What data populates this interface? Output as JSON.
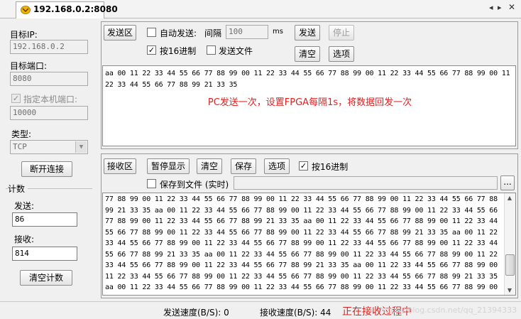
{
  "tab": {
    "title": "192.168.0.2:8080"
  },
  "left": {
    "target_ip_label": "目标IP:",
    "target_ip": "192.168.0.2",
    "target_port_label": "目标端口:",
    "target_port": "8080",
    "local_port_label": "指定本机端口:",
    "local_port": "10000",
    "type_label": "类型:",
    "type_value": "TCP",
    "disconnect_button": "断开连接",
    "count_group": "计数",
    "send_label": "发送:",
    "send_count": "86",
    "recv_label": "接收:",
    "recv_count": "814",
    "clear_count_button": "清空计数"
  },
  "send_panel": {
    "title": "发送区",
    "auto_send_label": "自动发送:",
    "interval_label": "间隔",
    "interval_value": "100",
    "interval_unit": "ms",
    "send_button": "发送",
    "stop_button": "停止",
    "hex_label": "按16进制",
    "send_file_label": "发送文件",
    "clear_button": "清空",
    "options_button": "选项",
    "content": "aa 00 11 22 33 44 55 66 77 88 99 00 11 22 33 44 55 66 77 88 99 00 11 22 33 44 55 66 77 88 99 00 11 22 33 44 55 66 77 88 99 21 33 35",
    "annotation": "PC发送一次，设置FPGA每隔1s，将数据回发一次"
  },
  "recv_panel": {
    "title": "接收区",
    "pause_button": "暂停显示",
    "clear_button": "清空",
    "save_button": "保存",
    "options_button": "选项",
    "hex_label": "按16进制",
    "save_to_file_label": "保存到文件 (实时)",
    "browse_button": "...",
    "content": "77 88 99 00 11 22 33 44 55 66 77 88 99 00 11 22 33 44 55 66 77 88 99 00 11 22 33 44 55 66 77 88 99 21 33 35 aa 00 11 22 33 44 55 66 77 88 99 00 11 22 33 44 55 66 77 88 99 00 11 22 33 44 55 66 77 88 99 00 11 22 33 44 55 66 77 88 99 21 33 35 aa 00 11 22 33 44 55 66 77 88 99 00 11 22 33 44 55 66 77 88 99 00 11 22 33 44 55 66 77 88 99 00 11 22 33 44 55 66 77 88 99 21 33 35 aa 00 11 22 33 44 55 66 77 88 99 00 11 22 33 44 55 66 77 88 99 00 11 22 33 44 55 66 77 88 99 00 11 22 33 44 55 66 77 88 99 21 33 35 aa 00 11 22 33 44 55 66 77 88 99 00 11 22 33 44 55 66 77 88 99 00 11 22 33 44 55 66 77 88 99 00 11 22 33 44 55 66 77 88 99 21 33 35 aa 00 11 22 33 44 55 66 77 88 99 00 11 22 33 44 55 66 77 88 99 00 11 22 33 44 55 66 77 88 99 00 11 22 33 44 55 66 77 88 99 21 33 35 aa 00 11 22 33 44 55 66 77 88 99 00 11 22 33 44 55 66 77 88 99 00 11 22 33 44 55 66 77 88 99 00 11 22 33 44 55 66 77 88 99 21 33 35",
    "scroll_position": 0.85
  },
  "status": {
    "send_speed": "发送速度(B/S): 0",
    "recv_speed": "接收速度(B/S): 44",
    "annotation": "正在接收过程中",
    "watermark": "https://blog.csdn.net/qq_21394333"
  },
  "colors": {
    "annotation": "#e02020"
  }
}
